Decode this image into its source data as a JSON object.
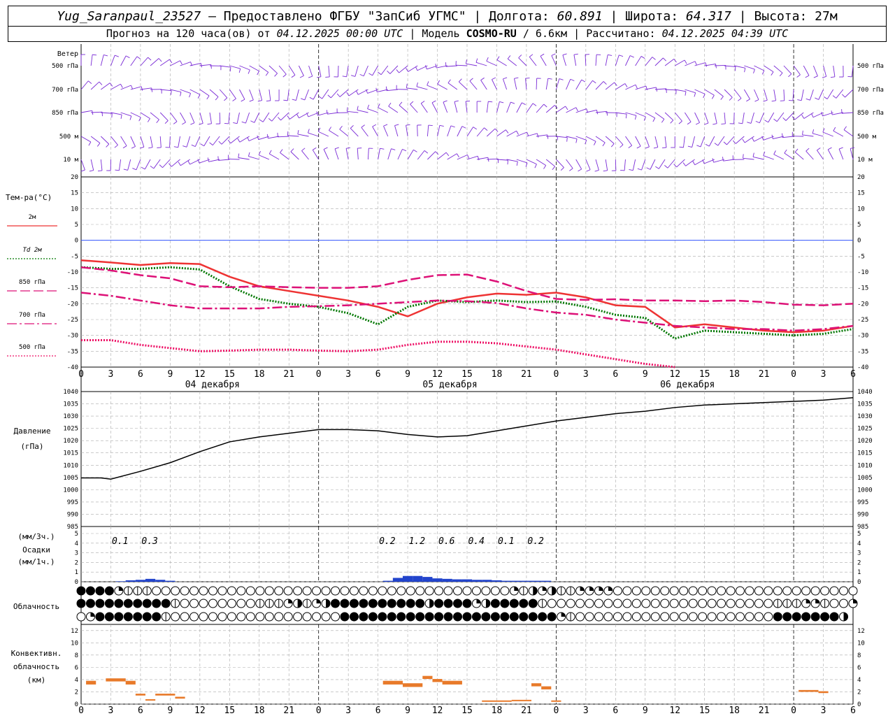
{
  "header": {
    "station": "Yug_Saranpaul_23527",
    "dash": " — ",
    "provider": "Предоставлено ФГБУ \"ЗапСиб УГМС\"",
    "lon_label": "Долгота:",
    "lon": "60.891",
    "lat_label": "Широта:",
    "lat": "64.317",
    "alt_label": "Высота:",
    "alt": "27м",
    "forecast_label": "Прогноз на 120 часа(ов) от",
    "start_time": "04.12.2025 00:00 UTC",
    "model_label": "Модель",
    "model": "COSMO-RU",
    "resolution": "/ 6.6км",
    "calc_label": "Рассчитано:",
    "calc_time": "04.12.2025 04:39 UTC",
    "sep": "|"
  },
  "time_axis": {
    "hour_labels": [
      "0",
      "3",
      "6",
      "9",
      "12",
      "15",
      "18",
      "21",
      "0",
      "3",
      "6",
      "9",
      "12",
      "15",
      "18",
      "21",
      "0",
      "3",
      "6",
      "9",
      "12",
      "15",
      "18",
      "21",
      "0",
      "3",
      "6"
    ],
    "day_labels": [
      "04 декабря",
      "05 декабря",
      "06 декабря"
    ]
  },
  "chart_data": [
    {
      "type": "wind_barbs",
      "title": "Ветер",
      "levels": [
        "500 гПа",
        "700 гПа",
        "850 гПа",
        "500 м",
        "10 м"
      ],
      "speed_note": "barbs"
    },
    {
      "type": "line",
      "ylabel": "Тем-ра(°C)",
      "ylim": [
        -40,
        20
      ],
      "yticks": [
        -40,
        -35,
        -30,
        -25,
        -20,
        -15,
        -10,
        -5,
        0,
        5,
        10,
        15,
        20
      ],
      "x_hours": [
        0,
        3,
        6,
        9,
        12,
        15,
        18,
        21,
        24,
        27,
        30,
        33,
        36,
        39,
        42,
        45,
        48,
        51,
        54,
        57,
        60,
        63,
        66,
        69,
        72,
        75,
        78
      ],
      "series": [
        {
          "name": "2м",
          "color": "#ee3333",
          "style": "solid",
          "values": [
            -6.3,
            -7.0,
            -7.8,
            -7.2,
            -7.5,
            -11.5,
            -14.5,
            -16.0,
            -17.5,
            -19.0,
            -21.0,
            -24.0,
            -20.0,
            -18.0,
            -16.8,
            -17.2,
            -16.5,
            -18.0,
            -20.5,
            -21.0,
            -27.5,
            -26.5,
            -27.5,
            -28.5,
            -29.0,
            -28.5,
            -27.0
          ]
        },
        {
          "name": "Td 2м",
          "color": "#007700",
          "style": "dotted",
          "values": [
            -8.5,
            -9.0,
            -9.0,
            -8.5,
            -9.2,
            -14.5,
            -18.5,
            -20.0,
            -21.0,
            -23.0,
            -26.5,
            -21.0,
            -19.0,
            -19.5,
            -19.0,
            -19.5,
            -19.3,
            -21.0,
            -23.5,
            -24.5,
            -31.0,
            -28.5,
            -29.0,
            -29.5,
            -30.0,
            -29.5,
            -28.0
          ]
        },
        {
          "name": "850 гПа",
          "color": "#dd1177",
          "style": "dashed",
          "values": [
            -8.5,
            -9.5,
            -11.0,
            -12.0,
            -14.5,
            -14.8,
            -14.5,
            -14.8,
            -15.0,
            -15.0,
            -14.5,
            -12.5,
            -11.0,
            -10.8,
            -13.0,
            -16.0,
            -18.5,
            -18.8,
            -18.6,
            -19.0,
            -19.0,
            -19.2,
            -19.0,
            -19.5,
            -20.3,
            -20.5,
            -20.0
          ]
        },
        {
          "name": "700 гПа",
          "color": "#dd1177",
          "style": "dashdot",
          "values": [
            -16.5,
            -17.5,
            -19.0,
            -20.5,
            -21.5,
            -21.5,
            -21.5,
            -21.0,
            -20.8,
            -20.5,
            -20.0,
            -19.5,
            -19.0,
            -19.2,
            -19.8,
            -21.5,
            -22.8,
            -23.5,
            -25.0,
            -26.0,
            -27.0,
            -27.5,
            -28.0,
            -28.0,
            -28.5,
            -28.0,
            -27.0
          ]
        },
        {
          "name": "500 гПа",
          "color": "#ee1166",
          "style": "dotted",
          "values": [
            -31.5,
            -31.5,
            -33.0,
            -34.0,
            -35.0,
            -34.8,
            -34.5,
            -34.5,
            -34.8,
            -35.0,
            -34.5,
            -33.0,
            -32.0,
            -32.0,
            -32.5,
            -33.5,
            -34.5,
            -36.0,
            -37.5,
            -39.0,
            -40.0,
            null,
            null,
            null,
            null,
            null,
            null
          ]
        }
      ]
    },
    {
      "type": "line",
      "ylabel": "Давление",
      "ylabel2": "(гПа)",
      "ylim": [
        985,
        1040
      ],
      "yticks": [
        985,
        990,
        995,
        1000,
        1005,
        1010,
        1015,
        1020,
        1025,
        1030,
        1035,
        1040
      ],
      "x_hours": [
        0,
        2,
        3,
        6,
        9,
        12,
        15,
        18,
        21,
        24,
        27,
        30,
        33,
        36,
        39,
        42,
        45,
        48,
        51,
        54,
        57,
        60,
        63,
        66,
        69,
        72,
        75,
        78
      ],
      "series": [
        {
          "name": "",
          "color": "#000000",
          "style": "solid",
          "values": [
            1004.8,
            1004.8,
            1004.3,
            1007.5,
            1011.0,
            1015.5,
            1019.5,
            1021.5,
            1023.0,
            1024.5,
            1024.5,
            1024.0,
            1022.5,
            1021.5,
            1022.0,
            1024.0,
            1026.0,
            1028.0,
            1029.5,
            1031.0,
            1032.0,
            1033.5,
            1034.5,
            1035.0,
            1035.5,
            1036.0,
            1036.5,
            1037.5
          ]
        }
      ]
    },
    {
      "type": "bar",
      "ylabel": "(мм/3ч.)",
      "ylabel2": "Осадки",
      "ylabel3": "(мм/1ч.)",
      "ylim": [
        0,
        5
      ],
      "yticks": [
        0,
        1,
        2,
        3,
        4,
        5
      ],
      "totals_3h": [
        {
          "hour": 4.5,
          "label": "0.1"
        },
        {
          "hour": 7.5,
          "label": "0.3"
        },
        {
          "hour": 31.5,
          "label": "0.2"
        },
        {
          "hour": 34.5,
          "label": "1.2"
        },
        {
          "hour": 37.5,
          "label": "0.6"
        },
        {
          "hour": 40.5,
          "label": "0.4"
        },
        {
          "hour": 43.5,
          "label": "0.1"
        },
        {
          "hour": 46.5,
          "label": "0.2"
        }
      ],
      "hourly": [
        {
          "hour": 4,
          "value": 0.05
        },
        {
          "hour": 5,
          "value": 0.15
        },
        {
          "hour": 6,
          "value": 0.2
        },
        {
          "hour": 7,
          "value": 0.3
        },
        {
          "hour": 8,
          "value": 0.2
        },
        {
          "hour": 9,
          "value": 0.1
        },
        {
          "hour": 31,
          "value": 0.1
        },
        {
          "hour": 32,
          "value": 0.4
        },
        {
          "hour": 33,
          "value": 0.6
        },
        {
          "hour": 34,
          "value": 0.6
        },
        {
          "hour": 35,
          "value": 0.5
        },
        {
          "hour": 36,
          "value": 0.35
        },
        {
          "hour": 37,
          "value": 0.3
        },
        {
          "hour": 38,
          "value": 0.25
        },
        {
          "hour": 39,
          "value": 0.25
        },
        {
          "hour": 40,
          "value": 0.2
        },
        {
          "hour": 41,
          "value": 0.2
        },
        {
          "hour": 42,
          "value": 0.15
        },
        {
          "hour": 43,
          "value": 0.1
        },
        {
          "hour": 44,
          "value": 0.1
        },
        {
          "hour": 45,
          "value": 0.1
        },
        {
          "hour": 46,
          "value": 0.1
        },
        {
          "hour": 47,
          "value": 0.1
        }
      ]
    },
    {
      "type": "cloud_symbols",
      "label": "Облачность",
      "rows": [
        "44442111000000000000000000000000000000000000002132311222200000000000000000000000000",
        "44444444441000000001112312344444444443444423444441000000000000000000000000111221002",
        "0244444441000000000000000000444444444444444444444442100000000000000000000044444443"
      ]
    },
    {
      "type": "bar",
      "ylabel": "Конвективн.",
      "ylabel2": "облачность",
      "ylabel3": "(км)",
      "ylim": [
        0,
        13
      ],
      "yticks": [
        0,
        2,
        4,
        6,
        8,
        10,
        12
      ],
      "segments": [
        {
          "x0": 0.5,
          "x1": 1.5,
          "bottom": 3.2,
          "top": 3.8
        },
        {
          "x0": 2.5,
          "x1": 4.5,
          "bottom": 3.7,
          "top": 4.2
        },
        {
          "x0": 4.5,
          "x1": 5.5,
          "bottom": 3.2,
          "top": 3.8
        },
        {
          "x0": 5.5,
          "x1": 6.5,
          "bottom": 1.4,
          "top": 1.7
        },
        {
          "x0": 6.5,
          "x1": 7.5,
          "bottom": 0.6,
          "top": 0.8
        },
        {
          "x0": 7.5,
          "x1": 9.5,
          "bottom": 1.4,
          "top": 1.7
        },
        {
          "x0": 9.5,
          "x1": 10.5,
          "bottom": 0.9,
          "top": 1.2
        },
        {
          "x0": 30.5,
          "x1": 32.5,
          "bottom": 3.2,
          "top": 3.8
        },
        {
          "x0": 32.5,
          "x1": 34.5,
          "bottom": 2.8,
          "top": 3.4
        },
        {
          "x0": 34.5,
          "x1": 35.5,
          "bottom": 4.1,
          "top": 4.6
        },
        {
          "x0": 35.5,
          "x1": 36.5,
          "bottom": 3.6,
          "top": 4.1
        },
        {
          "x0": 36.5,
          "x1": 38.5,
          "bottom": 3.2,
          "top": 3.8
        },
        {
          "x0": 40.5,
          "x1": 43.5,
          "bottom": 0.4,
          "top": 0.6
        },
        {
          "x0": 43.5,
          "x1": 45.5,
          "bottom": 0.5,
          "top": 0.7
        },
        {
          "x0": 45.5,
          "x1": 46.5,
          "bottom": 2.9,
          "top": 3.4
        },
        {
          "x0": 46.5,
          "x1": 47.5,
          "bottom": 2.4,
          "top": 2.9
        },
        {
          "x0": 47.5,
          "x1": 48.5,
          "bottom": 0.4,
          "top": 0.6
        },
        {
          "x0": 72.5,
          "x1": 74.5,
          "bottom": 2.0,
          "top": 2.3
        },
        {
          "x0": 74.5,
          "x1": 75.5,
          "bottom": 1.8,
          "top": 2.1
        }
      ]
    }
  ],
  "legend": [
    {
      "label": "2м",
      "color": "#ee3333",
      "style": "solid"
    },
    {
      "label": "Td 2м",
      "color": "#007700",
      "style": "dotted"
    },
    {
      "label": "850 гПа",
      "color": "#dd1177",
      "style": "dashed"
    },
    {
      "label": "700 гПа",
      "color": "#dd1177",
      "style": "dashdot"
    },
    {
      "label": "500 гПа",
      "color": "#ee1166",
      "style": "dotted"
    }
  ],
  "colors": {
    "wind": "#7a2bd6",
    "precip": "#2244cc",
    "conv": "#e87a2a",
    "grid": "#aaaaaa",
    "zero": "#3355ff"
  }
}
